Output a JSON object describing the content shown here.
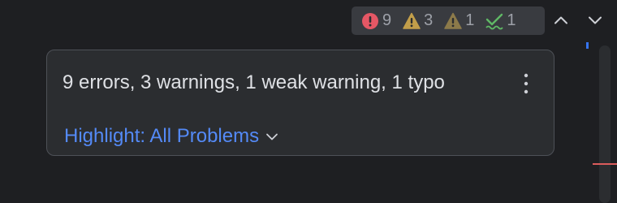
{
  "inspection_widget": {
    "errors": {
      "icon": "error-icon",
      "count": "9",
      "color": "#e55765"
    },
    "warnings": {
      "icon": "warning-icon",
      "count": "3",
      "color": "#c29e4a"
    },
    "weak_warnings": {
      "icon": "weak-warning-icon",
      "count": "1",
      "color": "#8c7a4a"
    },
    "typos": {
      "icon": "typo-icon",
      "count": "1",
      "color": "#5fb865"
    },
    "previous_icon": "chevron-up-icon",
    "next_icon": "chevron-down-icon"
  },
  "popup": {
    "summary": "9 errors, 3 warnings, 1 weak warning, 1 typo",
    "more_icon": "more-vertical-icon",
    "highlight_label": "Highlight: All Problems",
    "highlight_icon": "chevron-down-icon",
    "link_color": "#548af7"
  }
}
